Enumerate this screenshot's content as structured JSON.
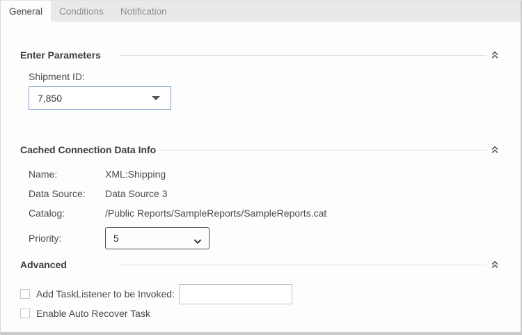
{
  "tabs": [
    {
      "label": "General",
      "active": true
    },
    {
      "label": "Conditions",
      "active": false
    },
    {
      "label": "Notification",
      "active": false
    }
  ],
  "sections": {
    "parameters": {
      "title": "Enter Parameters",
      "shipment_label": "Shipment ID:",
      "shipment_value": "7,850"
    },
    "cached": {
      "title": "Cached Connection Data Info",
      "rows": [
        {
          "label": "Name:",
          "value": "XML:Shipping"
        },
        {
          "label": "Data Source:",
          "value": "Data Source 3"
        },
        {
          "label": "Catalog:",
          "value": "/Public Reports/SampleReports/SampleReports.cat"
        }
      ],
      "priority_label": "Priority:",
      "priority_value": "5"
    },
    "advanced": {
      "title": "Advanced",
      "tasklistener_label": "Add TaskListener to be Invoked:",
      "tasklistener_value": "",
      "autorecover_label": "Enable Auto Recover Task"
    }
  },
  "icons": {
    "collapse": "double-chevron-up",
    "combo_arrow": "caret-down",
    "select_arrow": "chevron-down"
  },
  "colors": {
    "accent_border": "#7b9cce",
    "tabbar_bg": "#e9e9e9",
    "window_bg": "#fdfdfd",
    "text": "#4a4a4a",
    "inactive_tab_text": "#8f8f8f",
    "section_line": "#d9ddd9",
    "select_border": "#4f4f4f",
    "checkbox_border": "#c6c6c6",
    "input_border": "#c2c2c2",
    "bottom_strip": "#c7cbc7"
  }
}
